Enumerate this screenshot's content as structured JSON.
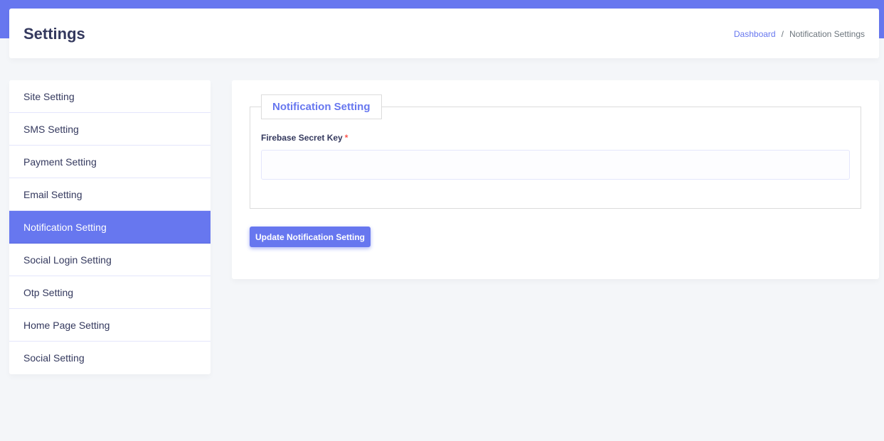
{
  "colors": {
    "accent": "#6777ef",
    "background": "#f4f6f9",
    "required": "#fc544b"
  },
  "header": {
    "title": "Settings",
    "breadcrumb": {
      "home": "Dashboard",
      "separator": "/",
      "current": "Notification Settings"
    }
  },
  "sidebar": {
    "items": [
      {
        "label": "Site Setting"
      },
      {
        "label": "SMS Setting"
      },
      {
        "label": "Payment Setting"
      },
      {
        "label": "Email Setting"
      },
      {
        "label": "Notification Setting"
      },
      {
        "label": "Social Login Setting"
      },
      {
        "label": "Otp Setting"
      },
      {
        "label": "Home Page Setting"
      },
      {
        "label": "Social Setting"
      }
    ],
    "active": "Notification Setting"
  },
  "form": {
    "legend": "Notification Setting",
    "field": {
      "label": "Firebase Secret Key",
      "required_mark": "*",
      "value": "",
      "placeholder": ""
    },
    "submit_label": "Update Notification Setting"
  }
}
